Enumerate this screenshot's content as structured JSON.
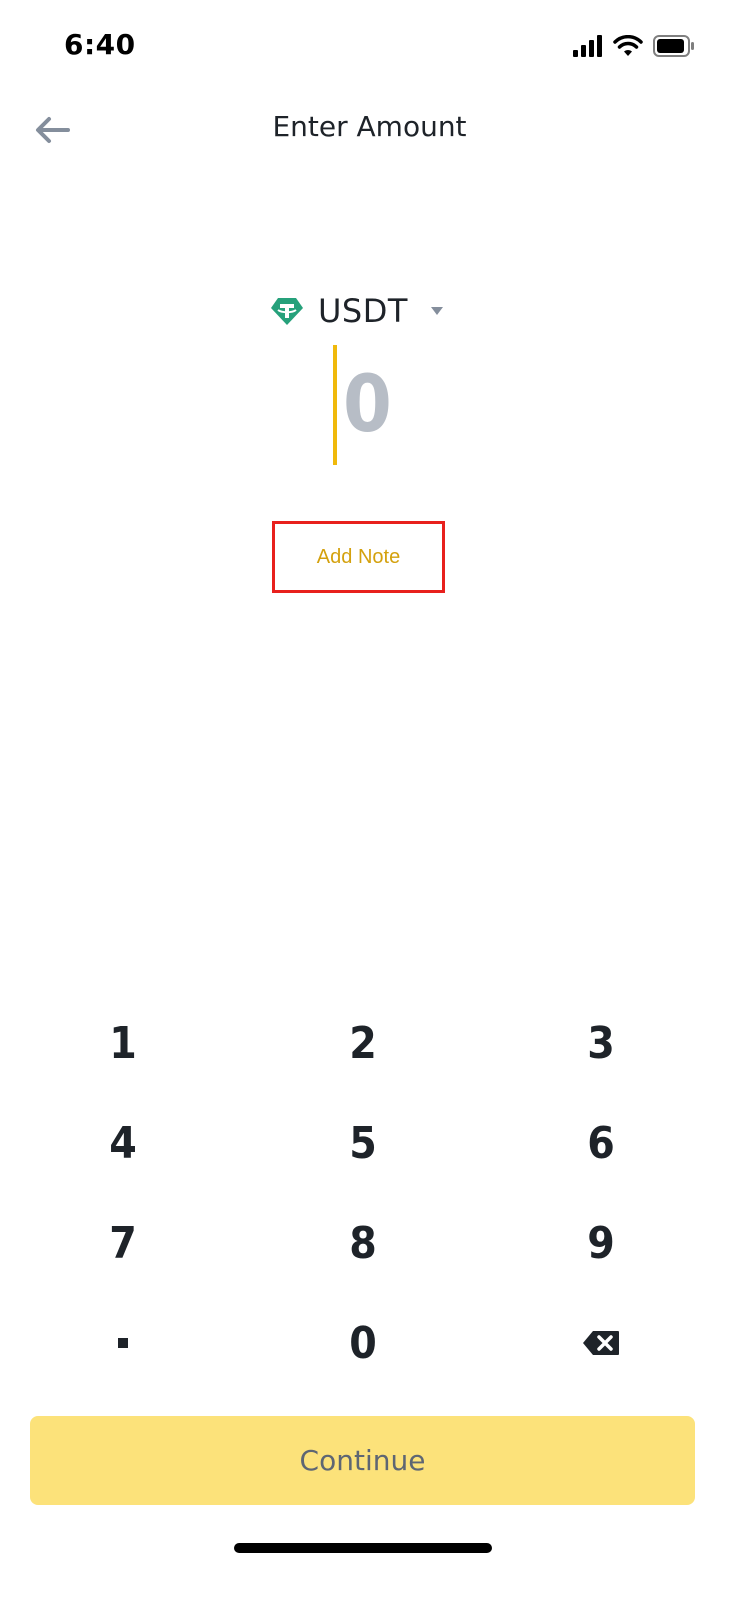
{
  "status_bar": {
    "time": "6:40",
    "icons": [
      "cellular-signal-icon",
      "wifi-icon",
      "battery-icon"
    ]
  },
  "header": {
    "back_icon": "arrow-left-icon",
    "title": "Enter Amount"
  },
  "currency": {
    "icon": "tether-icon",
    "name": "USDT",
    "dropdown_icon": "caret-down-icon",
    "brand_color": "#26a17b"
  },
  "amount": {
    "value": "0",
    "cursor_color": "#f0b90b"
  },
  "add_note": {
    "label": "Add Note",
    "highlight_color": "#e8201d"
  },
  "keypad": {
    "keys": [
      "1",
      "2",
      "3",
      "4",
      "5",
      "6",
      "7",
      "8",
      "9",
      "·",
      "0",
      "backspace"
    ],
    "backspace_icon": "backspace-icon"
  },
  "continue": {
    "label": "Continue",
    "color": "#fce27a"
  }
}
